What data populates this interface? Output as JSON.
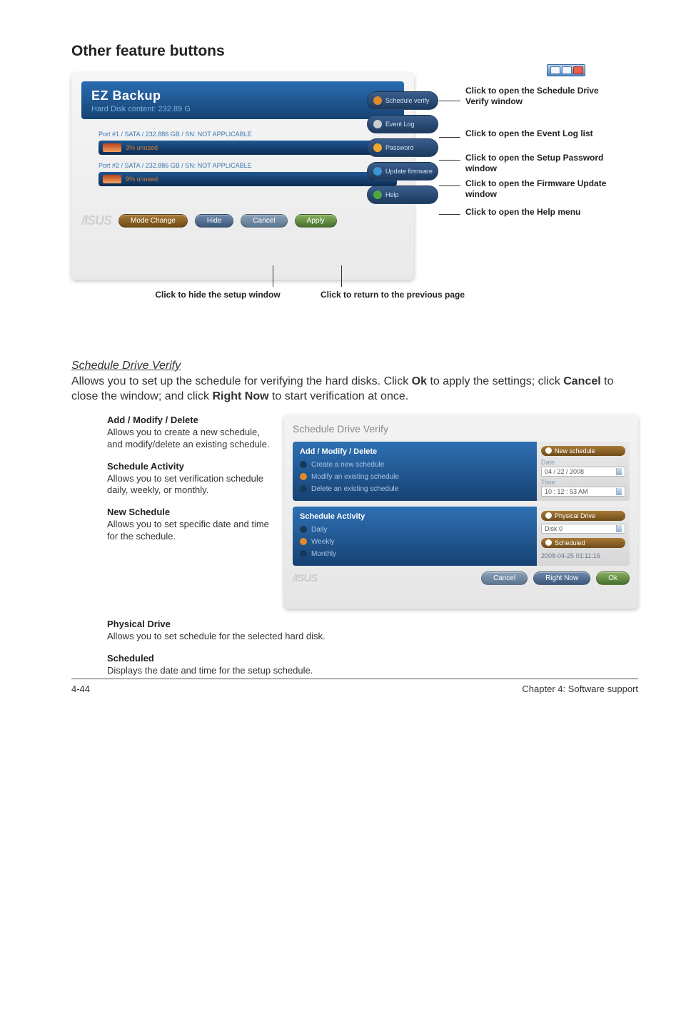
{
  "heading": "Other feature buttons",
  "ezbackup": {
    "title": "EZ Backup",
    "subtitle": "Hard Disk content: 232.89 G",
    "port1": "Port #1 / SATA / 232.886 GB / SN: NOT APPLICABLE",
    "usage1": "3% unused",
    "port2": "Port #2 / SATA / 232.886 GB / SN: NOT APPLICABLE",
    "usage2": "9% unused",
    "btn_mode": "Mode Change",
    "btn_hide": "Hide",
    "btn_cancel": "Cancel",
    "btn_apply": "Apply"
  },
  "rtabs": {
    "sv": "Schedule verify",
    "ev": "Event Log",
    "pw": "Password",
    "fw": "Update firmware",
    "hp": "Help"
  },
  "annot": {
    "sv": "Click to open the Schedule Drive Verify window",
    "ev": "Click to open the Event Log list",
    "pw": "Click to open the Setup Password window",
    "fw": "Click to open the Firmware Update window",
    "hp": "Click to open the Help menu",
    "hide": "Click to hide the setup window",
    "cancel": "Click to return to the previous page"
  },
  "schedule_intro": {
    "title": "Schedule Drive Verify",
    "body_1": "Allows you to set up the schedule for verifying the hard disks. Click ",
    "ok": "Ok",
    "body_2": " to apply the settings; click ",
    "cancel": "Cancel",
    "body_3": " to close the window; and click ",
    "rightnow": "Right Now",
    "body_4": " to start verification at once."
  },
  "desc": {
    "amd_t": "Add / Modify / Delete",
    "amd_b": "Allows you to create a new schedule, and modify/delete an existing schedule.",
    "sa_t": "Schedule Activity",
    "sa_b": "Allows you to set verification schedule daily, weekly, or monthly.",
    "ns_t": "New Schedule",
    "ns_b": "Allows you to set specific date and time for the schedule.",
    "pd_t": "Physical Drive",
    "pd_b": "Allows you to set schedule for the selected hard disk.",
    "sch_t": "Scheduled",
    "sch_b": "Displays the date and time for the setup schedule."
  },
  "sdv": {
    "title": "Schedule Drive Verify",
    "amd_hdr": "Add / Modify / Delete",
    "amd_1": "Create a new schedule",
    "amd_2": "Modify an existing schedule",
    "amd_3": "Delete an existing schedule",
    "sa_hdr": "Schedule Activity",
    "sa_1": "Daily",
    "sa_2": "Weekly",
    "sa_3": "Monthly",
    "pill_ns": "New schedule",
    "lbl_date": "Date",
    "val_date": "04 / 22 / 2008",
    "lbl_time": "Time",
    "val_time": "10 : 12 : 53 AM",
    "pill_pd": "Physical Drive",
    "val_disk": "Disk 0",
    "pill_sch": "Scheduled",
    "val_sch": "2008-04-25    01:11:16",
    "btn_cancel": "Cancel",
    "btn_rightnow": "Right Now",
    "btn_ok": "Ok"
  },
  "footer": {
    "left": "4-44",
    "right": "Chapter 4: Software support"
  }
}
